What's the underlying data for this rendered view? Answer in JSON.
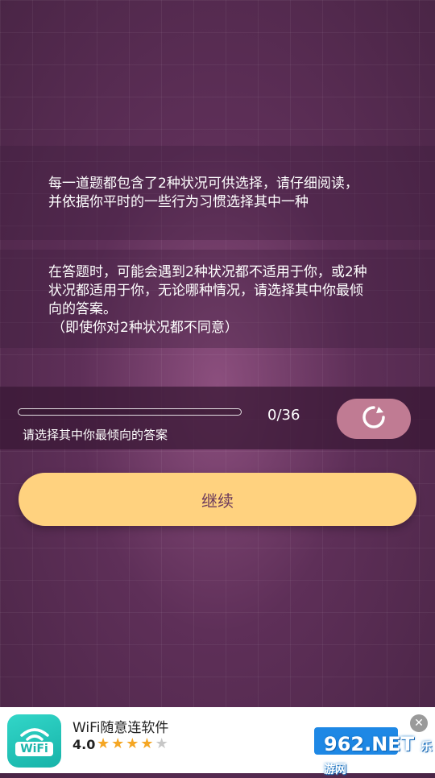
{
  "instructions": {
    "paragraph1": [
      "每一道题都包含了2种状况可供选择，请仔细阅读，",
      "并依据你平时的一些行为习惯选择其中一种"
    ],
    "paragraph2": [
      "在答题时，可能会遇到2种状况都不适用于你，或2种",
      "状况都适用于你，无论哪种情况，请选择其中你最倾",
      "向的答案。",
      "（即使你对2种状况都不同意）"
    ]
  },
  "progress": {
    "fraction": 0,
    "count_text": "0/36",
    "hint": "请选择其中你最倾向的答案"
  },
  "reset_icon": "refresh-icon",
  "continue_label": "继续",
  "colors": {
    "accent": "#ffd27f",
    "reset_button": "#c07b93",
    "background": "#5e2f58"
  },
  "ad": {
    "icon_text": "WiFi",
    "title": "WiFi随意连软件",
    "rating": "4.0",
    "stars_filled": 4,
    "stars_total": 5,
    "close_icon": "close-icon"
  },
  "watermark": {
    "main": "962.NET",
    "sub": "乐游网"
  }
}
